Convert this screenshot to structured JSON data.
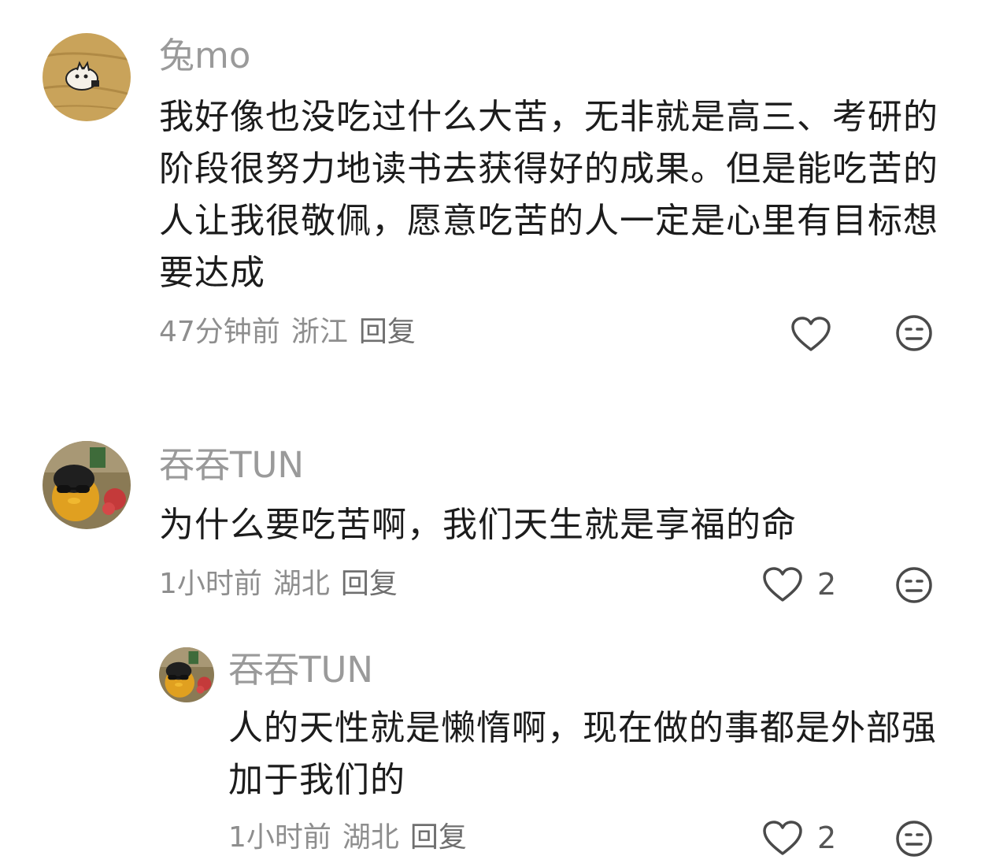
{
  "comments": [
    {
      "username": "兔mo",
      "avatar_icon": "cat-sketch-avatar",
      "text": "我好像也没吃过什么大苦，无非就是高三、考研的阶段很努力地读书去获得好的成果。但是能吃苦的人让我很敬佩，愿意吃苦的人一定是心里有目标想要达成",
      "time": "47分钟前",
      "location": "浙江",
      "reply_label": "回复",
      "like_count": ""
    },
    {
      "username": "吞吞TUN",
      "avatar_icon": "duck-sunglasses-avatar",
      "text": "为什么要吃苦啊，我们天生就是享福的命",
      "time": "1小时前",
      "location": "湖北",
      "reply_label": "回复",
      "like_count": "2",
      "replies": [
        {
          "username": "吞吞TUN",
          "avatar_icon": "duck-sunglasses-avatar",
          "text": "人的天性就是懒惰啊，现在做的事都是外部强加于我们的",
          "time": "1小时前",
          "location": "湖北",
          "reply_label": "回复",
          "like_count": "2"
        }
      ]
    }
  ],
  "icons": {
    "like": "heart-outline-icon",
    "dislike": "meh-face-icon"
  },
  "colors": {
    "username": "#9a9a9a",
    "content": "#1c1c1c",
    "meta": "#8e8e8e",
    "icon": "#4a4a4a"
  }
}
